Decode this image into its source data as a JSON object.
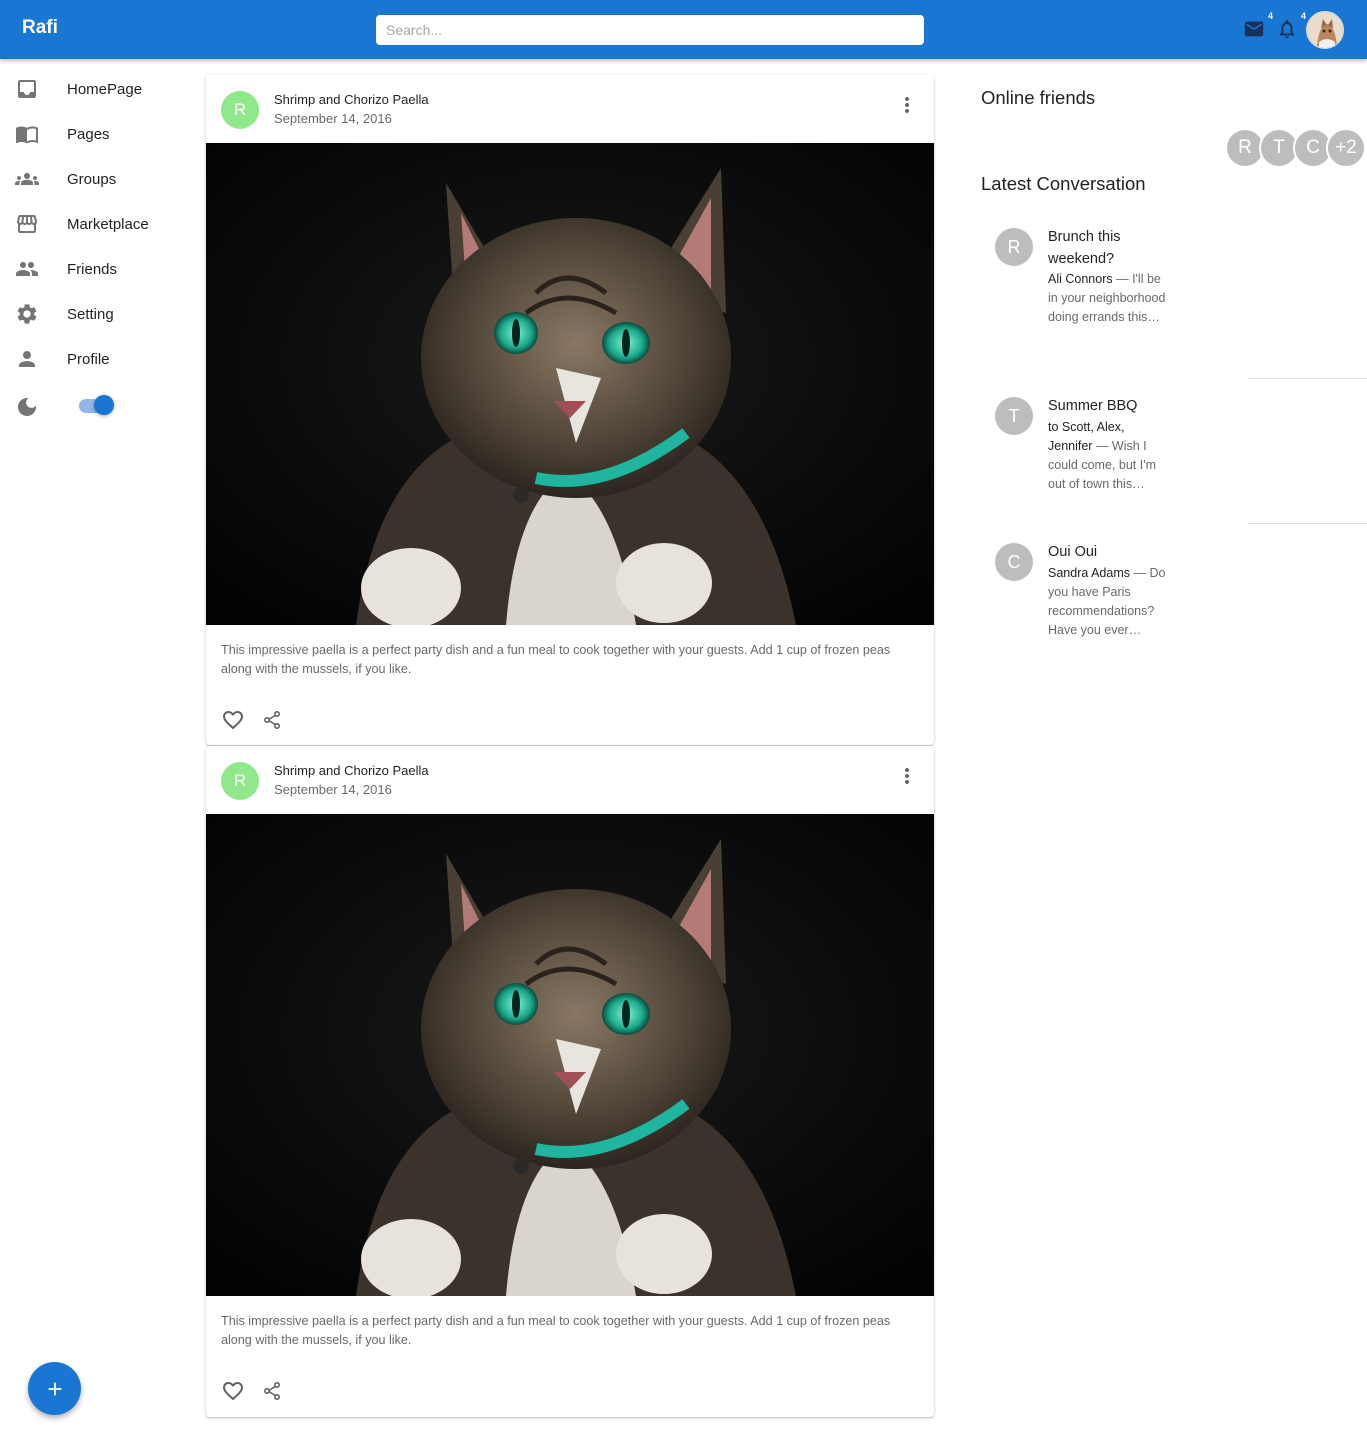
{
  "appbar": {
    "brand": "Rafi",
    "search_placeholder": "Search...",
    "mail_badge": "4",
    "notifications_badge": "4"
  },
  "sidebar": {
    "items": [
      {
        "label": "HomePage",
        "icon": "inbox-icon"
      },
      {
        "label": "Pages",
        "icon": "book-icon"
      },
      {
        "label": "Groups",
        "icon": "groups-icon"
      },
      {
        "label": "Marketplace",
        "icon": "storefront-icon"
      },
      {
        "label": "Friends",
        "icon": "people-icon"
      },
      {
        "label": "Setting",
        "icon": "gear-icon"
      },
      {
        "label": "Profile",
        "icon": "person-icon"
      }
    ],
    "dark_mode_icon": "moon-icon",
    "dark_mode_on": true
  },
  "feed": {
    "posts": [
      {
        "avatar_letter": "R",
        "title": "Shrimp and Chorizo Paella",
        "date": "September 14, 2016",
        "image": "cat-photo",
        "text": "This impressive paella is a perfect party dish and a fun meal to cook together with your guests. Add 1 cup of frozen peas along with the mussels, if you like."
      },
      {
        "avatar_letter": "R",
        "title": "Shrimp and Chorizo Paella",
        "date": "September 14, 2016",
        "image": "cat-photo",
        "text": "This impressive paella is a perfect party dish and a fun meal to cook together with your guests. Add 1 cup of frozen peas along with the mussels, if you like."
      }
    ]
  },
  "online_friends": {
    "title": "Online friends",
    "avatars": [
      "R",
      "T",
      "C"
    ],
    "more": "+2"
  },
  "latest_conversation": {
    "title": "Latest Conversation",
    "items": [
      {
        "letter": "R",
        "title": "Brunch this weekend?",
        "name": "Ali Connors",
        "preview": " — I'll be in your neighborhood doing errands this…"
      },
      {
        "letter": "T",
        "title": "Summer BBQ",
        "name": "to Scott, Alex, Jennifer",
        "preview": " — Wish I could come, but I'm out of town this…"
      },
      {
        "letter": "C",
        "title": "Oui Oui",
        "name": "Sandra Adams",
        "preview": " — Do you have Paris recommendations? Have you ever…"
      }
    ]
  },
  "colors": {
    "primary": "#1976d2",
    "post_avatar": "#8fe98a",
    "friend_avatar": "#bdbdbd"
  }
}
